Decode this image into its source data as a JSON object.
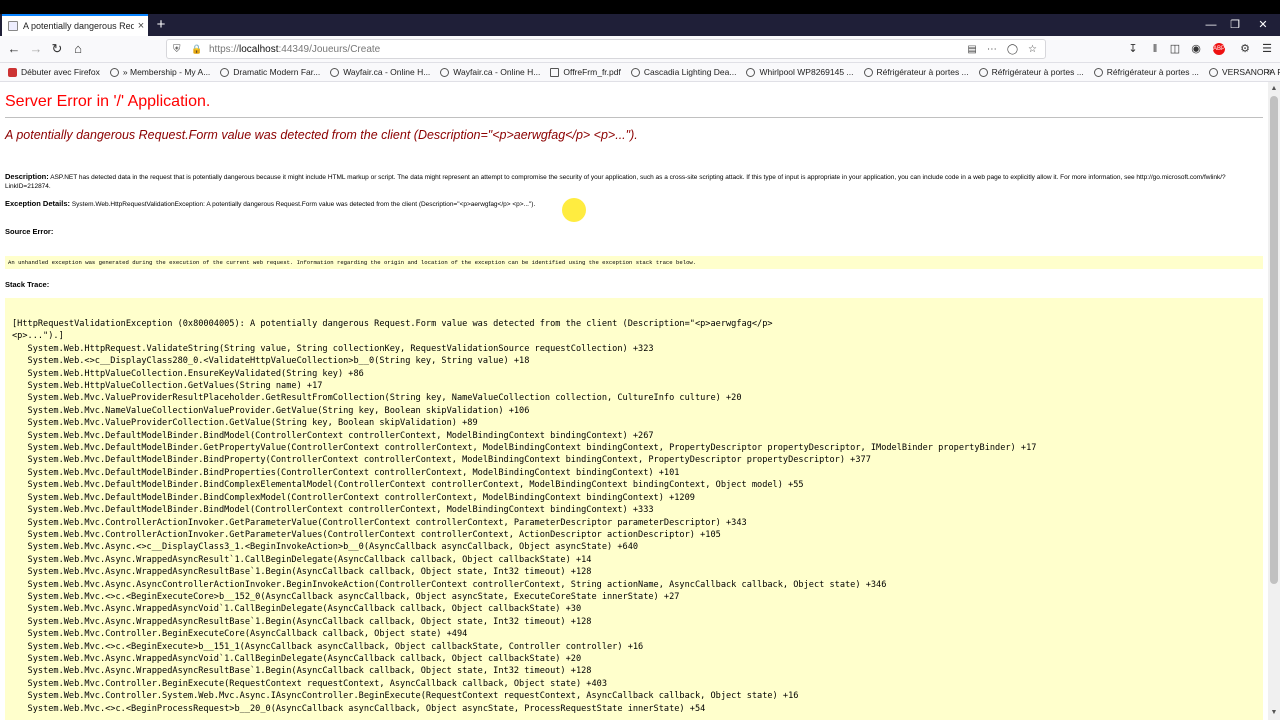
{
  "browser": {
    "tab_title": "A potentially dangerous Requ...",
    "tab_close": "×",
    "new_tab": "+",
    "window_controls": [
      "—",
      "❐",
      "✕"
    ],
    "url_scheme": "https://",
    "url_host": "localhost",
    "url_rest": ":44349/Joueurs/Create",
    "bookmarks": [
      {
        "label": "Débuter avec Firefox",
        "icon": "firefox-icon"
      },
      {
        "label": "» Membership - My A...",
        "icon": "globe-icon"
      },
      {
        "label": "Dramatic Modern Far...",
        "icon": "globe-icon"
      },
      {
        "label": "Wayfair.ca - Online H...",
        "icon": "globe-icon"
      },
      {
        "label": "Wayfair.ca - Online H...",
        "icon": "globe-icon"
      },
      {
        "label": "OffreFrm_fr.pdf",
        "icon": "pdf-icon"
      },
      {
        "label": "Cascadia Lighting Dea...",
        "icon": "globe-icon"
      },
      {
        "label": "Whirlpool WP8269145 ...",
        "icon": "globe-icon"
      },
      {
        "label": "Réfrigérateur à portes ...",
        "icon": "globe-icon"
      },
      {
        "label": "Réfrigérateur à portes ...",
        "icon": "globe-icon"
      },
      {
        "label": "Réfrigérateur à portes ...",
        "icon": "globe-icon"
      },
      {
        "label": "VERSANORA Romanza...",
        "icon": "globe-icon"
      }
    ],
    "bookmarks_more": "»",
    "abp_label": "ABP"
  },
  "page": {
    "app_error": "Server Error in '/' Application.",
    "error_message": "A potentially dangerous Request.Form value was detected from the client (Description=\"<p>aerwgfag</p>\n<p>...\").",
    "description_label": "Description:",
    "description_text": "ASP.NET has detected data in the request that is potentially dangerous because it might include HTML markup or script. The data might represent an attempt to compromise the security of your application, such as a cross-site scripting attack. If this type of input is appropriate in your application, you can include code in a web page to explicitly allow it. For more information, see http://go.microsoft.com/fwlink/?LinkID=212874.",
    "exception_label": "Exception Details:",
    "exception_text": "System.Web.HttpRequestValidationException: A potentially dangerous Request.Form value was detected from the client (Description=\"<p>aerwgfag</p>\n<p>...\").",
    "source_error_label": "Source Error:",
    "source_error_text": "An unhandled exception was generated during the execution of the current web request. Information regarding the origin and location of the exception can be identified using the exception stack trace below.",
    "stack_trace_label": "Stack Trace:",
    "stack_trace": "[HttpRequestValidationException (0x80004005): A potentially dangerous Request.Form value was detected from the client (Description=\"<p>aerwgfag</p>\n<p>...\").]\n   System.Web.HttpRequest.ValidateString(String value, String collectionKey, RequestValidationSource requestCollection) +323\n   System.Web.<>c__DisplayClass280_0.<ValidateHttpValueCollection>b__0(String key, String value) +18\n   System.Web.HttpValueCollection.EnsureKeyValidated(String key) +86\n   System.Web.HttpValueCollection.GetValues(String name) +17\n   System.Web.Mvc.ValueProviderResultPlaceholder.GetResultFromCollection(String key, NameValueCollection collection, CultureInfo culture) +20\n   System.Web.Mvc.NameValueCollectionValueProvider.GetValue(String key, Boolean skipValidation) +106\n   System.Web.Mvc.ValueProviderCollection.GetValue(String key, Boolean skipValidation) +89\n   System.Web.Mvc.DefaultModelBinder.BindModel(ControllerContext controllerContext, ModelBindingContext bindingContext) +267\n   System.Web.Mvc.DefaultModelBinder.GetPropertyValue(ControllerContext controllerContext, ModelBindingContext bindingContext, PropertyDescriptor propertyDescriptor, IModelBinder propertyBinder) +17\n   System.Web.Mvc.DefaultModelBinder.BindProperty(ControllerContext controllerContext, ModelBindingContext bindingContext, PropertyDescriptor propertyDescriptor) +377\n   System.Web.Mvc.DefaultModelBinder.BindProperties(ControllerContext controllerContext, ModelBindingContext bindingContext) +101\n   System.Web.Mvc.DefaultModelBinder.BindComplexElementalModel(ControllerContext controllerContext, ModelBindingContext bindingContext, Object model) +55\n   System.Web.Mvc.DefaultModelBinder.BindComplexModel(ControllerContext controllerContext, ModelBindingContext bindingContext) +1209\n   System.Web.Mvc.DefaultModelBinder.BindModel(ControllerContext controllerContext, ModelBindingContext bindingContext) +333\n   System.Web.Mvc.ControllerActionInvoker.GetParameterValue(ControllerContext controllerContext, ParameterDescriptor parameterDescriptor) +343\n   System.Web.Mvc.ControllerActionInvoker.GetParameterValues(ControllerContext controllerContext, ActionDescriptor actionDescriptor) +105\n   System.Web.Mvc.Async.<>c__DisplayClass3_1.<BeginInvokeAction>b__0(AsyncCallback asyncCallback, Object asyncState) +640\n   System.Web.Mvc.Async.WrappedAsyncResult`1.CallBeginDelegate(AsyncCallback callback, Object callbackState) +14\n   System.Web.Mvc.Async.WrappedAsyncResultBase`1.Begin(AsyncCallback callback, Object state, Int32 timeout) +128\n   System.Web.Mvc.Async.AsyncControllerActionInvoker.BeginInvokeAction(ControllerContext controllerContext, String actionName, AsyncCallback callback, Object state) +346\n   System.Web.Mvc.<>c.<BeginExecuteCore>b__152_0(AsyncCallback asyncCallback, Object asyncState, ExecuteCoreState innerState) +27\n   System.Web.Mvc.Async.WrappedAsyncVoid`1.CallBeginDelegate(AsyncCallback callback, Object callbackState) +30\n   System.Web.Mvc.Async.WrappedAsyncResultBase`1.Begin(AsyncCallback callback, Object state, Int32 timeout) +128\n   System.Web.Mvc.Controller.BeginExecuteCore(AsyncCallback callback, Object state) +494\n   System.Web.Mvc.<>c.<BeginExecute>b__151_1(AsyncCallback asyncCallback, Object callbackState, Controller controller) +16\n   System.Web.Mvc.Async.WrappedAsyncVoid`1.CallBeginDelegate(AsyncCallback callback, Object callbackState) +20\n   System.Web.Mvc.Async.WrappedAsyncResultBase`1.Begin(AsyncCallback callback, Object state, Int32 timeout) +128\n   System.Web.Mvc.Controller.BeginExecute(RequestContext requestContext, AsyncCallback callback, Object state) +403\n   System.Web.Mvc.Controller.System.Web.Mvc.Async.IAsyncController.BeginExecute(RequestContext requestContext, AsyncCallback callback, Object state) +16\n   System.Web.Mvc.<>c.<BeginProcessRequest>b__20_0(AsyncCallback asyncCallback, Object asyncState, ProcessRequestState innerState) +54"
  }
}
